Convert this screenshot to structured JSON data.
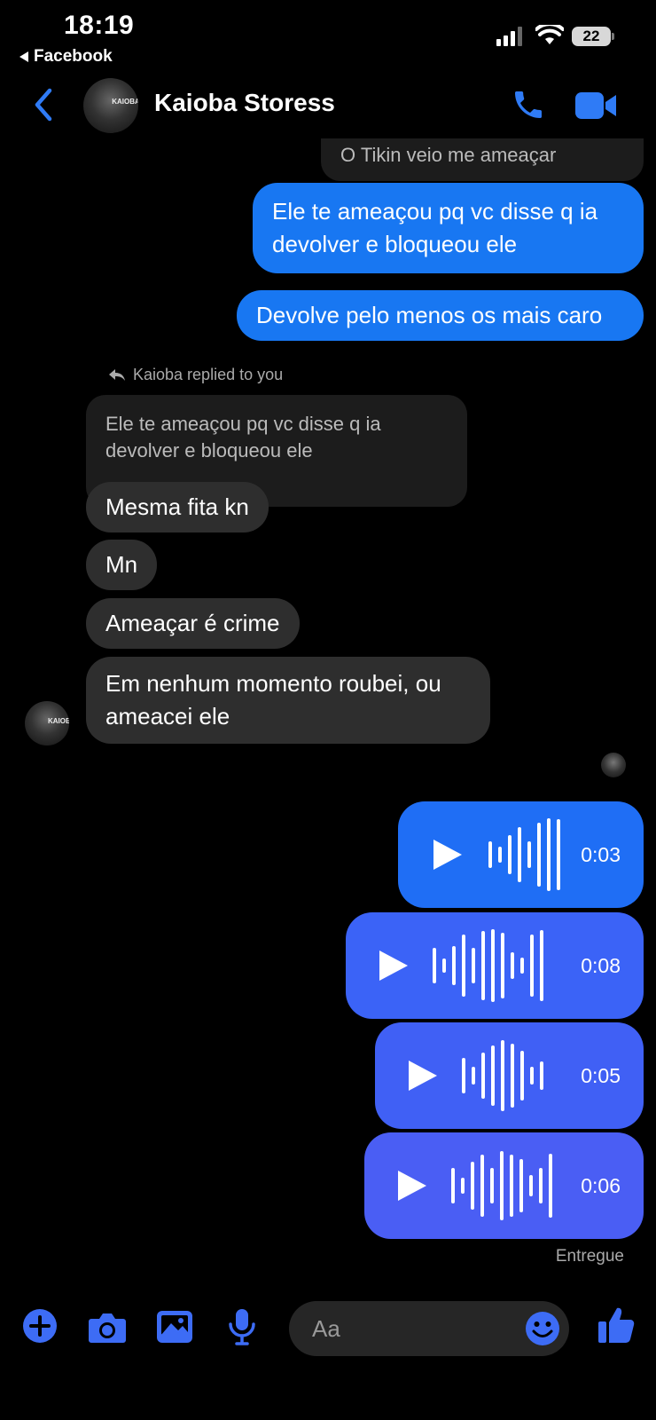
{
  "status_bar": {
    "time": "18:19",
    "back_app": "Facebook",
    "battery": "22"
  },
  "header": {
    "contact_name": "Kaioba Storess",
    "avatar_text": "KAIOBA"
  },
  "messages": {
    "partial_incoming": "O Tikin veio me ameaçar",
    "out1": "Ele te ameaçou pq vc disse q ia devolver e bloqueou ele",
    "out2": "Devolve pelo menos os mais caro",
    "reply_label": "Kaioba replied to you",
    "quoted": "Ele te ameaçou pq vc disse q ia devolver e bloqueou ele",
    "in1": "Mesma fita kn",
    "in2": "Mn",
    "in3": "Ameaçar é crime",
    "in4": "Em nenhum momento roubei, ou ameacei ele"
  },
  "voice_messages": [
    {
      "duration": "0:03"
    },
    {
      "duration": "0:08"
    },
    {
      "duration": "0:05"
    },
    {
      "duration": "0:06"
    }
  ],
  "delivery_status": "Entregue",
  "composer": {
    "placeholder": "Aa"
  },
  "colors": {
    "accent": "#1877f2",
    "voice_bubble_1": "#1f6ef5",
    "voice_bubble_2": "#3b63f7",
    "voice_bubble_3": "#4060f5",
    "voice_bubble_4": "#4a5ef4",
    "icon_blue": "#3d6cf5"
  },
  "icons": [
    "back-icon",
    "phone-icon",
    "video-icon",
    "plus-icon",
    "camera-icon",
    "gallery-icon",
    "microphone-icon",
    "emoji-icon",
    "thumbs-up-icon",
    "play-icon",
    "reply-arrow-icon"
  ]
}
